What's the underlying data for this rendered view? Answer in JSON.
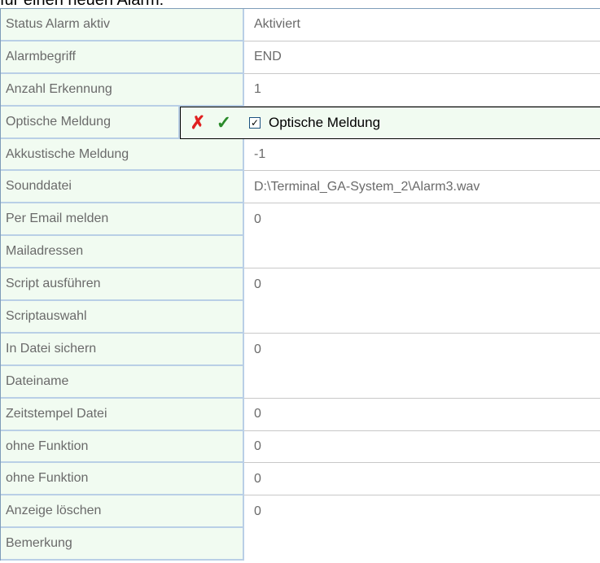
{
  "caption": "für einen neuen Alarm:",
  "rows": [
    {
      "label": "Status Alarm aktiv",
      "value": "Aktiviert"
    },
    {
      "label": "Alarmbegriff",
      "value": "END"
    },
    {
      "label": "Anzahl Erkennung",
      "value": "1"
    },
    {
      "label": "Optische Meldung",
      "value": ""
    },
    {
      "label": "Akkustische Meldung",
      "value": "-1"
    },
    {
      "label": "Sounddatei",
      "value": "D:\\Terminal_GA-System_2\\Alarm3.wav"
    },
    {
      "label": "Per Email melden",
      "value": "0"
    },
    {
      "label": "Mailadressen",
      "value": ""
    },
    {
      "label": "Script ausführen",
      "value": "0"
    },
    {
      "label": "Scriptauswahl",
      "value": ""
    },
    {
      "label": "In Datei sichern",
      "value": "0"
    },
    {
      "label": "Dateiname",
      "value": ""
    },
    {
      "label": "Zeitstempel Datei",
      "value": "0"
    },
    {
      "label": "ohne Funktion",
      "value": "0"
    },
    {
      "label": "ohne Funktion",
      "value": "0"
    },
    {
      "label": "Anzeige löschen",
      "value": "0"
    },
    {
      "label": "Bemerkung",
      "value": ""
    }
  ],
  "editor": {
    "cancel_icon": "✗",
    "ok_icon": "✓",
    "checkbox_checked": true,
    "checkbox_mark": "✓",
    "checkbox_label": "Optische Meldung"
  }
}
